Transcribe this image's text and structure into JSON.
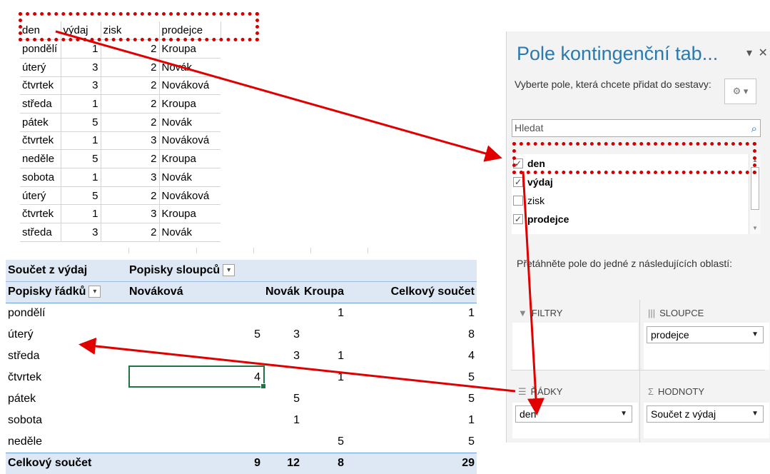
{
  "source_table": {
    "headers": [
      "den",
      "výdaj",
      "zisk",
      "prodejce"
    ],
    "rows": [
      [
        "pondělí",
        "1",
        "2",
        "Kroupa"
      ],
      [
        "úterý",
        "3",
        "2",
        "Novák"
      ],
      [
        "čtvrtek",
        "3",
        "2",
        "Nováková"
      ],
      [
        "středa",
        "1",
        "2",
        "Kroupa"
      ],
      [
        "pátek",
        "5",
        "2",
        "Novák"
      ],
      [
        "čtvrtek",
        "1",
        "3",
        "Nováková"
      ],
      [
        "neděle",
        "5",
        "2",
        "Kroupa"
      ],
      [
        "sobota",
        "1",
        "3",
        "Novák"
      ],
      [
        "úterý",
        "5",
        "2",
        "Nováková"
      ],
      [
        "čtvrtek",
        "1",
        "3",
        "Kroupa"
      ],
      [
        "středa",
        "3",
        "2",
        "Novák"
      ]
    ]
  },
  "pivot": {
    "value_label": "Součet z výdaj",
    "column_labels": "Popisky sloupců",
    "row_labels": "Popisky řádků",
    "columns": [
      "Nováková",
      "Novák",
      "Kroupa",
      "Celkový součet"
    ],
    "rows": [
      {
        "label": "pondělí",
        "values": [
          "",
          "",
          "1",
          "1"
        ]
      },
      {
        "label": "úterý",
        "values": [
          "5",
          "3",
          "",
          "8"
        ]
      },
      {
        "label": "středa",
        "values": [
          "",
          "3",
          "1",
          "4"
        ]
      },
      {
        "label": "čtvrtek",
        "values": [
          "4",
          "",
          "1",
          "5"
        ]
      },
      {
        "label": "pátek",
        "values": [
          "",
          "5",
          "",
          "5"
        ]
      },
      {
        "label": "sobota",
        "values": [
          "",
          "1",
          "",
          "1"
        ]
      },
      {
        "label": "neděle",
        "values": [
          "",
          "",
          "5",
          "5"
        ]
      }
    ],
    "total_label": "Celkový součet",
    "totals": [
      "9",
      "12",
      "8",
      "29"
    ]
  },
  "panel": {
    "title": "Pole kontingenční tab...",
    "controls": "▾ ✕",
    "subtitle": "Vyberte pole, která chcete přidat do sestavy:",
    "search_placeholder": "Hledat",
    "fields": [
      {
        "label": "den",
        "checked": "✓"
      },
      {
        "label": "výdaj",
        "checked": "✓"
      },
      {
        "label": "zisk",
        "checked": ""
      },
      {
        "label": "prodejce",
        "checked": "✓"
      }
    ],
    "drag_hint": "Přetáhněte pole do jedné z následujících oblastí:",
    "areas": {
      "filters": "FILTRY",
      "columns": "SLOUPCE",
      "rows": "ŘÁDKY",
      "values": "HODNOTY",
      "columns_chip": "prodejce",
      "rows_chip": "den",
      "values_chip": "Součet z výdaj"
    }
  },
  "icons": {
    "gear": "gear-icon",
    "search": "search-icon",
    "filter": "filter-icon",
    "columns": "columns-icon",
    "rows": "rows-icon",
    "sum": "sum-icon"
  },
  "colors": {
    "annotation_red": "#e00000",
    "pivot_header": "#dde8f4",
    "panel_title": "#2a7ab0",
    "selection": "#217346"
  }
}
